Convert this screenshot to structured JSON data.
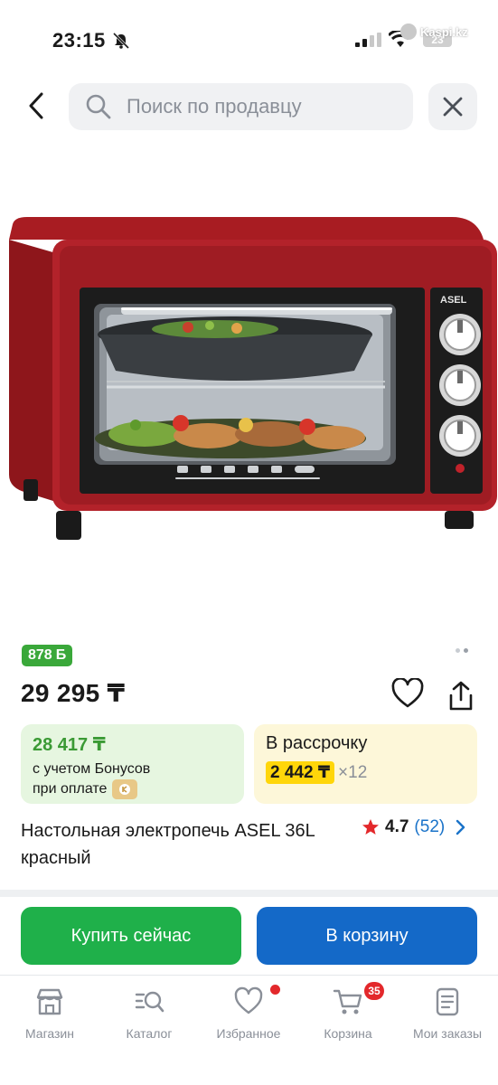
{
  "status_bar": {
    "time": "23:15",
    "battery": "23",
    "watermark": "Kaspi.kz"
  },
  "header": {
    "search_placeholder": "Поиск по продавцу"
  },
  "product": {
    "bonus_badge": "878",
    "bonus_symbol": "Б",
    "price": "29 295 ₸",
    "title": "Настольная электропечь ASEL 36L красный",
    "brand_on_image": "ASEL",
    "rating": "4.7",
    "reviews": "(52)"
  },
  "bonus_card": {
    "amount": "28 417 ₸",
    "line1": "с учетом Бонусов",
    "line2": "при оплате"
  },
  "installment_card": {
    "title": "В рассрочку",
    "monthly": "2 442 ₸",
    "months": "×12"
  },
  "actions": {
    "buy_now": "Купить сейчас",
    "add_to_cart": "В корзину"
  },
  "tabbar": {
    "items": [
      {
        "label": "Магазин",
        "icon": "shop-icon"
      },
      {
        "label": "Каталог",
        "icon": "catalog-search-icon"
      },
      {
        "label": "Избранное",
        "icon": "heart-icon"
      },
      {
        "label": "Корзина",
        "icon": "cart-icon",
        "badge": "35"
      },
      {
        "label": "Мои заказы",
        "icon": "orders-icon"
      }
    ]
  },
  "colors": {
    "green": "#1fb04a",
    "blue": "#1469c8",
    "badge_red": "#e3282b",
    "bonus_green": "#3aa83a"
  }
}
